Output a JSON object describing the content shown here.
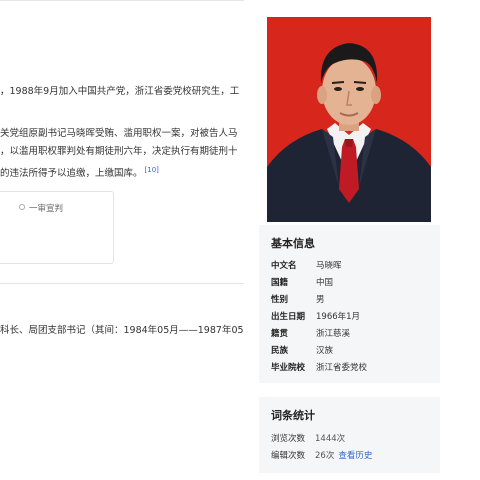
{
  "article": {
    "intro": "，1988年9月加入中国共产党，浙江省委党校研究生，工",
    "case_lines": [
      "关党组原副书记马晓晖受贿、滥用职权一案，对被告人马",
      "，以滥用职权罪判处有期徒刑六年，决定执行有期徒刑十",
      "的违法所得予以追缴，上缴国库。"
    ],
    "case_ref": "[10]",
    "trial_node": "一审宣判",
    "career": "科长、局团支部书记（其间：1984年05月——1987年05"
  },
  "infobox": {
    "title": "基本信息",
    "rows": [
      {
        "key": "中文名",
        "value": "马晓晖"
      },
      {
        "key": "国籍",
        "value": "中国"
      },
      {
        "key": "性别",
        "value": "男"
      },
      {
        "key": "出生日期",
        "value": "1966年1月"
      },
      {
        "key": "籍贯",
        "value": "浙江慈溪"
      },
      {
        "key": "民族",
        "value": "汉族"
      },
      {
        "key": "毕业院校",
        "value": "浙江省委党校"
      }
    ]
  },
  "stats": {
    "title": "词条统计",
    "views_label": "浏览次数",
    "views_value": "1444次",
    "edits_label": "编辑次数",
    "edits_value": "26次",
    "history_link": "查看历史"
  },
  "colors": {
    "photo_bg": "#d7261c",
    "link": "#3366cc",
    "panel_bg": "#f5f6f7"
  }
}
